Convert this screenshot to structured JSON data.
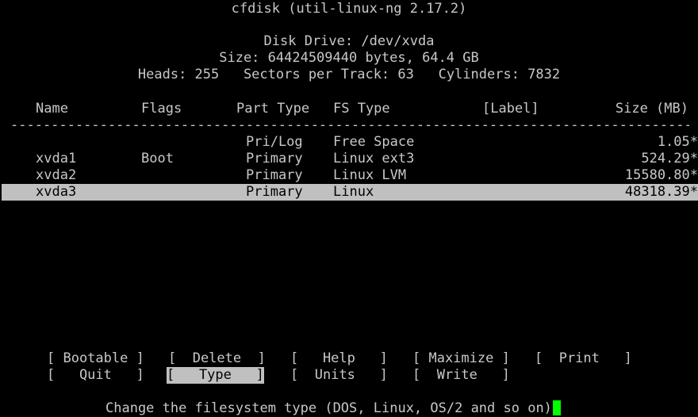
{
  "header": {
    "title": "cfdisk (util-linux-ng 2.17.2)",
    "drive": "Disk Drive: /dev/xvda",
    "size": "Size: 64424509440 bytes, 64.4 GB",
    "geometry": "Heads: 255   Sectors per Track: 63   Cylinders: 7832"
  },
  "table": {
    "columns": [
      "Name",
      "Flags",
      "Part Type",
      "FS Type",
      "[Label]",
      "Size (MB)"
    ],
    "separator": "--------------------------------------------------------------------------------------------------------------------",
    "rows": [
      {
        "name": "",
        "flags": "",
        "part_type": "Pri/Log",
        "fs_type": "Free Space",
        "label": "",
        "size": "1.05*"
      },
      {
        "name": "xvda1",
        "flags": "Boot",
        "part_type": "Primary",
        "fs_type": "Linux ext3",
        "label": "",
        "size": "524.29*"
      },
      {
        "name": "xvda2",
        "flags": "",
        "part_type": "Primary",
        "fs_type": "Linux LVM",
        "label": "",
        "size": "15580.80*"
      },
      {
        "name": "xvda3",
        "flags": "",
        "part_type": "Primary",
        "fs_type": "Linux",
        "label": "",
        "size": "48318.39*"
      }
    ]
  },
  "menu": {
    "bootable": "[ Bootable ]",
    "delete": "[  Delete  ]",
    "help": "[   Help   ]",
    "maximize": "[ Maximize ]",
    "print": "[  Print   ]",
    "quit": "[   Quit   ]",
    "type": "[   Type   ]",
    "units": "[  Units   ]",
    "write": "[  Write   ]"
  },
  "status": {
    "message": "Change the filesystem type (DOS, Linux, OS/2 and so on)"
  },
  "colors": {
    "background": "#000000",
    "text": "#c8c8c8",
    "highlight": "#c0c0c0",
    "cursor": "#00ff00"
  }
}
